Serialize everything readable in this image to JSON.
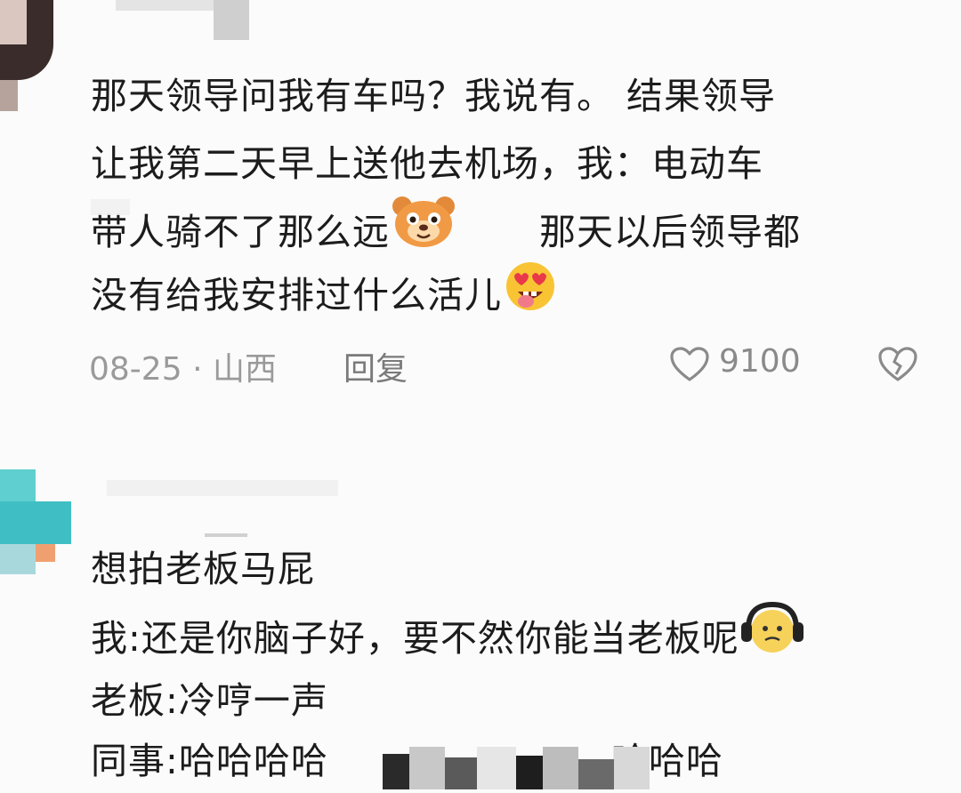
{
  "comment1": {
    "line1": "那天领导问我有车吗？我说有。 结果领导",
    "line2": "让我第二天早上送他去机场，我：电动车",
    "line3a": "带人骑不了那么远",
    "line3b": "那天以后领导都",
    "line4": "没有给我安排过什么活儿",
    "date": "08-25",
    "dot": "·",
    "location": "山西",
    "reply_label": "回复",
    "like_count": "9100",
    "emoji1": "bear-emoji-icon",
    "emoji2": "heart-eyes-emoji-icon"
  },
  "comment2": {
    "line1": "想拍老板马屁",
    "line2": "我:还是你脑子好，要不然你能当老板呢",
    "line3": "老板:冷哼一声",
    "line4_prefix": "同事:哈哈哈哈",
    "line4_suffix": "哈哈哈",
    "emoji1": "headphone-face-emoji-icon"
  }
}
